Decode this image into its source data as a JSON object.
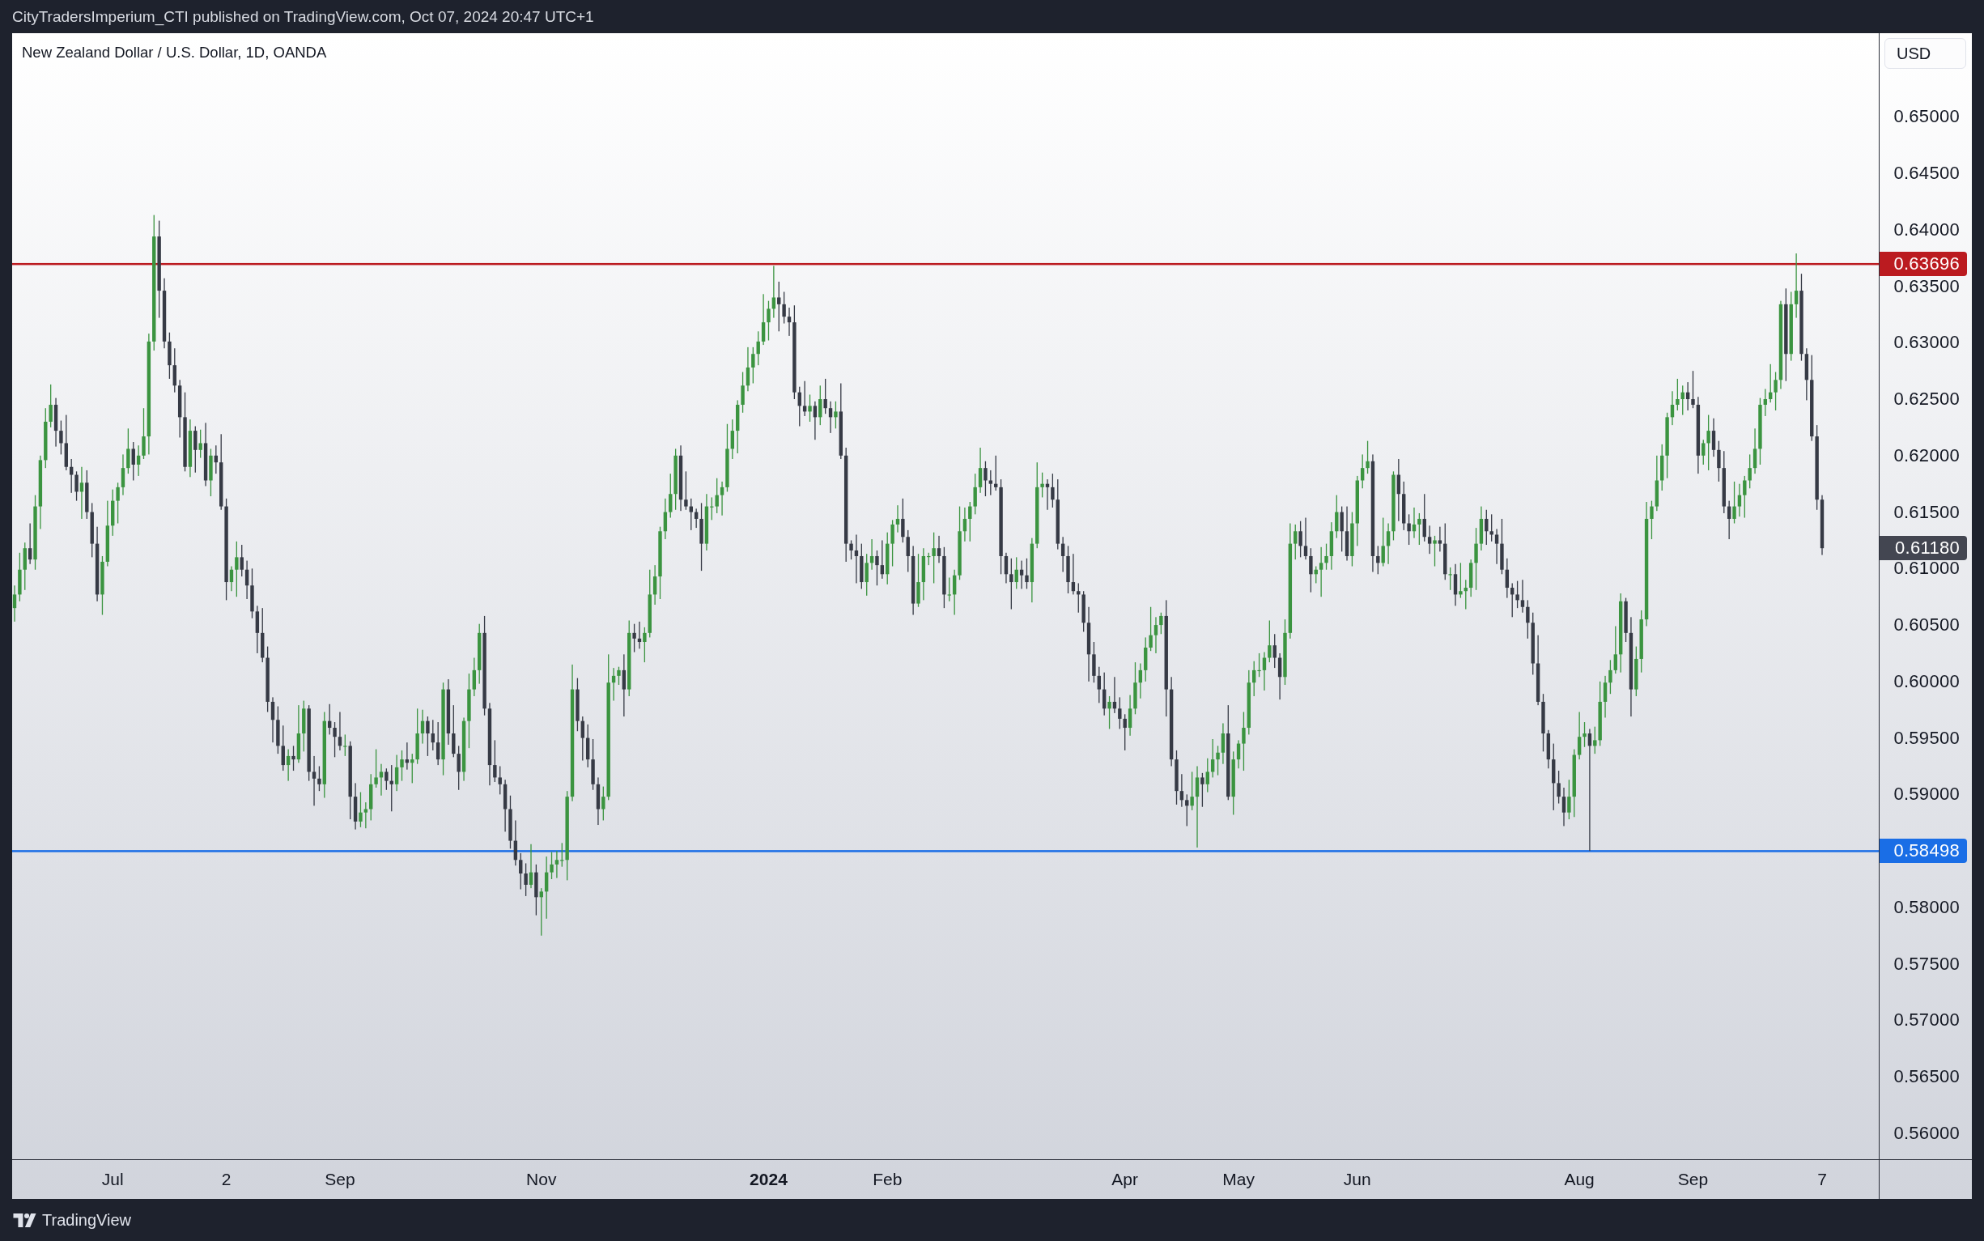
{
  "header": {
    "text": "CityTradersImperium_CTI published on TradingView.com, Oct 07, 2024 20:47 UTC+1"
  },
  "chart": {
    "legend": "New Zealand Dollar / U.S. Dollar, 1D, OANDA",
    "currency_button": "USD",
    "last_price": {
      "label": "0.61180"
    },
    "time_axis": {
      "labels": [
        {
          "bold": false
        },
        {
          "bold": false
        },
        {
          "bold": false
        },
        {
          "bold": false
        },
        {
          "bold": true
        },
        {
          "bold": false
        },
        {
          "bold": false
        },
        {
          "bold": false
        },
        {
          "bold": false
        },
        {
          "bold": false
        },
        {
          "bold": false
        },
        {
          "bold": false
        }
      ]
    },
    "chart_data": {
      "type": "candlestick",
      "ylim": [
        0.5577,
        0.6574
      ],
      "yticks": [
        {
          "value": 0.65,
          "label": "0.65000"
        },
        {
          "value": 0.645,
          "label": "0.64500"
        },
        {
          "value": 0.64,
          "label": "0.64000"
        },
        {
          "value": 0.635,
          "label": "0.63500"
        },
        {
          "value": 0.63,
          "label": "0.63000"
        },
        {
          "value": 0.625,
          "label": "0.62500"
        },
        {
          "value": 0.62,
          "label": "0.62000"
        },
        {
          "value": 0.615,
          "label": "0.61500"
        },
        {
          "value": 0.61,
          "label": "0.61000"
        },
        {
          "value": 0.605,
          "label": "0.60500"
        },
        {
          "value": 0.6,
          "label": "0.60000"
        },
        {
          "value": 0.595,
          "label": "0.59500"
        },
        {
          "value": 0.59,
          "label": "0.59000"
        },
        {
          "value": 0.58,
          "label": "0.58000"
        },
        {
          "value": 0.575,
          "label": "0.57500"
        },
        {
          "value": 0.57,
          "label": "0.57000"
        },
        {
          "value": 0.565,
          "label": "0.56500"
        },
        {
          "value": 0.56,
          "label": "0.56000"
        }
      ],
      "ref_lines": [
        {
          "axis": "y",
          "value": 0.63696,
          "label": "0.63696",
          "color": "#bb1b20"
        },
        {
          "axis": "y",
          "value": 0.58498,
          "label": "0.58498",
          "color": "#1a6ee6"
        }
      ],
      "categories": [
        null,
        null,
        null,
        null,
        null,
        null,
        null,
        null,
        null,
        null,
        null,
        null,
        null,
        null,
        null,
        null,
        null,
        null,
        null,
        "Jul",
        null,
        null,
        null,
        null,
        null,
        null,
        null,
        null,
        null,
        null,
        null,
        null,
        null,
        null,
        null,
        null,
        null,
        null,
        null,
        null,
        null,
        "2",
        null,
        null,
        null,
        null,
        null,
        null,
        null,
        null,
        null,
        null,
        null,
        null,
        null,
        null,
        null,
        null,
        null,
        null,
        null,
        null,
        null,
        "Sep",
        null,
        null,
        null,
        null,
        null,
        null,
        null,
        null,
        null,
        null,
        null,
        null,
        null,
        null,
        null,
        null,
        null,
        null,
        null,
        null,
        null,
        null,
        null,
        null,
        null,
        null,
        null,
        null,
        null,
        null,
        null,
        null,
        null,
        null,
        null,
        null,
        null,
        null,
        "Nov",
        null,
        null,
        null,
        null,
        null,
        null,
        null,
        null,
        null,
        null,
        null,
        null,
        null,
        null,
        null,
        null,
        null,
        null,
        null,
        null,
        null,
        null,
        null,
        null,
        null,
        null,
        null,
        null,
        null,
        null,
        null,
        null,
        null,
        null,
        null,
        null,
        null,
        null,
        null,
        null,
        null,
        null,
        null,
        "2024",
        null,
        null,
        null,
        null,
        null,
        null,
        null,
        null,
        null,
        null,
        null,
        null,
        null,
        null,
        null,
        null,
        null,
        null,
        null,
        null,
        null,
        null,
        "Feb",
        null,
        null,
        null,
        null,
        null,
        null,
        null,
        null,
        null,
        null,
        null,
        null,
        null,
        null,
        null,
        null,
        null,
        null,
        null,
        null,
        null,
        null,
        null,
        null,
        null,
        null,
        null,
        null,
        null,
        null,
        null,
        null,
        null,
        null,
        null,
        null,
        null,
        null,
        null,
        null,
        null,
        null,
        null,
        null,
        null,
        "Apr",
        null,
        null,
        null,
        null,
        null,
        null,
        null,
        null,
        null,
        null,
        null,
        null,
        null,
        null,
        null,
        null,
        null,
        null,
        null,
        null,
        null,
        "May",
        null,
        null,
        null,
        null,
        null,
        null,
        null,
        null,
        null,
        null,
        null,
        null,
        null,
        null,
        null,
        null,
        null,
        null,
        null,
        null,
        null,
        null,
        "Jun",
        null,
        null,
        null,
        null,
        null,
        null,
        null,
        null,
        null,
        null,
        null,
        null,
        null,
        null,
        null,
        null,
        null,
        null,
        null,
        null,
        null,
        null,
        null,
        null,
        null,
        null,
        null,
        null,
        null,
        null,
        null,
        null,
        null,
        null,
        null,
        null,
        null,
        null,
        null,
        null,
        null,
        null,
        "Aug",
        null,
        null,
        null,
        null,
        null,
        null,
        null,
        null,
        null,
        null,
        null,
        null,
        null,
        null,
        null,
        null,
        null,
        null,
        null,
        null,
        null,
        "Sep",
        null,
        null,
        null,
        null,
        null,
        null,
        null,
        null,
        null,
        null,
        null,
        null,
        null,
        null,
        null,
        null,
        null,
        null,
        null,
        null,
        null,
        null,
        null,
        null,
        "7"
      ],
      "ohlc": [
        [
          0.6065,
          0.6085,
          0.6053,
          0.6077
        ],
        [
          0.6077,
          0.6114,
          0.6071,
          0.6099
        ],
        [
          0.6099,
          0.6123,
          0.6081,
          0.6118
        ],
        [
          0.6118,
          0.614,
          0.6104,
          0.6108
        ],
        [
          0.6108,
          0.6165,
          0.6099,
          0.6155
        ],
        [
          0.6155,
          0.62,
          0.6135,
          0.6196
        ],
        [
          0.6196,
          0.6242,
          0.6189,
          0.623
        ],
        [
          0.623,
          0.6263,
          0.6225,
          0.6245
        ],
        [
          0.6245,
          0.6251,
          0.6208,
          0.6222
        ],
        [
          0.6222,
          0.6231,
          0.6201,
          0.6211
        ],
        [
          0.6211,
          0.6236,
          0.6187,
          0.619
        ],
        [
          0.619,
          0.6197,
          0.6167,
          0.6183
        ],
        [
          0.6183,
          0.6186,
          0.616,
          0.6168
        ],
        [
          0.6168,
          0.619,
          0.6144,
          0.6176
        ],
        [
          0.6176,
          0.6187,
          0.6144,
          0.615
        ],
        [
          0.615,
          0.6158,
          0.611,
          0.6122
        ],
        [
          0.6122,
          0.6137,
          0.6071,
          0.6077
        ],
        [
          0.6077,
          0.6111,
          0.6059,
          0.6106
        ],
        [
          0.6106,
          0.616,
          0.6102,
          0.6138
        ],
        [
          0.6138,
          0.617,
          0.6129,
          0.616
        ],
        [
          0.616,
          0.6176,
          0.614,
          0.6172
        ],
        [
          0.6172,
          0.6201,
          0.6165,
          0.6189
        ],
        [
          0.6189,
          0.6224,
          0.6184,
          0.6206
        ],
        [
          0.6206,
          0.6212,
          0.6178,
          0.6192
        ],
        [
          0.6192,
          0.6209,
          0.6182,
          0.62
        ],
        [
          0.62,
          0.6242,
          0.6197,
          0.6217
        ],
        [
          0.6217,
          0.6308,
          0.6201,
          0.6301
        ],
        [
          0.6301,
          0.6413,
          0.6293,
          0.6394
        ],
        [
          0.6394,
          0.6408,
          0.6322,
          0.6346
        ],
        [
          0.6346,
          0.6357,
          0.6295,
          0.6301
        ],
        [
          0.6301,
          0.6309,
          0.6268,
          0.628
        ],
        [
          0.628,
          0.6295,
          0.6256,
          0.6262
        ],
        [
          0.6262,
          0.6267,
          0.6216,
          0.6234
        ],
        [
          0.6234,
          0.6256,
          0.6186,
          0.619
        ],
        [
          0.619,
          0.6232,
          0.6181,
          0.6222
        ],
        [
          0.6222,
          0.6226,
          0.6185,
          0.6205
        ],
        [
          0.6205,
          0.6223,
          0.6198,
          0.6211
        ],
        [
          0.6211,
          0.6229,
          0.6173,
          0.6178
        ],
        [
          0.6178,
          0.6206,
          0.6164,
          0.62
        ],
        [
          0.62,
          0.6209,
          0.6184,
          0.6194
        ],
        [
          0.6194,
          0.6219,
          0.6152,
          0.6155
        ],
        [
          0.6155,
          0.6162,
          0.6072,
          0.6088
        ],
        [
          0.6088,
          0.6102,
          0.608,
          0.6099
        ],
        [
          0.6099,
          0.6124,
          0.6075,
          0.611
        ],
        [
          0.611,
          0.6121,
          0.6093,
          0.6099
        ],
        [
          0.6099,
          0.6107,
          0.6073,
          0.6085
        ],
        [
          0.6085,
          0.61,
          0.6056,
          0.6062
        ],
        [
          0.6062,
          0.6067,
          0.6025,
          0.6043
        ],
        [
          0.6043,
          0.6065,
          0.6017,
          0.6021
        ],
        [
          0.6021,
          0.6031,
          0.5973,
          0.5982
        ],
        [
          0.5982,
          0.5986,
          0.5946,
          0.5966
        ],
        [
          0.5966,
          0.5978,
          0.5936,
          0.5943
        ],
        [
          0.5943,
          0.5961,
          0.5921,
          0.5926
        ],
        [
          0.5926,
          0.594,
          0.5912,
          0.5934
        ],
        [
          0.5934,
          0.5943,
          0.5921,
          0.5931
        ],
        [
          0.5931,
          0.5979,
          0.5928,
          0.5954
        ],
        [
          0.5954,
          0.5983,
          0.5938,
          0.5976
        ],
        [
          0.5976,
          0.5979,
          0.5912,
          0.592
        ],
        [
          0.592,
          0.5934,
          0.589,
          0.5914
        ],
        [
          0.5914,
          0.5925,
          0.5903,
          0.5909
        ],
        [
          0.5909,
          0.5973,
          0.5897,
          0.5965
        ],
        [
          0.5965,
          0.598,
          0.5953,
          0.5959
        ],
        [
          0.5959,
          0.5964,
          0.5933,
          0.5951
        ],
        [
          0.5951,
          0.5973,
          0.5939,
          0.5943
        ],
        [
          0.5943,
          0.5953,
          0.5934,
          0.5943
        ],
        [
          0.5943,
          0.5947,
          0.5878,
          0.5898
        ],
        [
          0.5898,
          0.591,
          0.5869,
          0.5876
        ],
        [
          0.5876,
          0.5902,
          0.5871,
          0.5884
        ],
        [
          0.5884,
          0.5893,
          0.587,
          0.5887
        ],
        [
          0.5887,
          0.5918,
          0.5877,
          0.5909
        ],
        [
          0.5909,
          0.594,
          0.5906,
          0.5915
        ],
        [
          0.5915,
          0.5927,
          0.5899,
          0.592
        ],
        [
          0.592,
          0.5923,
          0.5904,
          0.5912
        ],
        [
          0.5912,
          0.5926,
          0.5885,
          0.5909
        ],
        [
          0.5909,
          0.5935,
          0.5903,
          0.5924
        ],
        [
          0.5924,
          0.5939,
          0.5912,
          0.5931
        ],
        [
          0.5931,
          0.5946,
          0.5922,
          0.5928
        ],
        [
          0.5928,
          0.5936,
          0.591,
          0.5931
        ],
        [
          0.5931,
          0.5976,
          0.5927,
          0.5954
        ],
        [
          0.5954,
          0.5975,
          0.5945,
          0.5965
        ],
        [
          0.5965,
          0.5969,
          0.5934,
          0.5954
        ],
        [
          0.5954,
          0.5966,
          0.5939,
          0.5946
        ],
        [
          0.5946,
          0.5964,
          0.5926,
          0.5931
        ],
        [
          0.5931,
          0.5999,
          0.5917,
          0.5993
        ],
        [
          0.5993,
          0.6002,
          0.5944,
          0.5954
        ],
        [
          0.5954,
          0.5979,
          0.5933,
          0.5936
        ],
        [
          0.5936,
          0.5943,
          0.5904,
          0.592
        ],
        [
          0.592,
          0.5968,
          0.5912,
          0.5965
        ],
        [
          0.5965,
          0.6007,
          0.5941,
          0.5993
        ],
        [
          0.5993,
          0.6021,
          0.5987,
          0.601
        ],
        [
          0.601,
          0.6051,
          0.5998,
          0.6043
        ],
        [
          0.6043,
          0.6058,
          0.597,
          0.5976
        ],
        [
          0.5976,
          0.5981,
          0.5908,
          0.5926
        ],
        [
          0.5926,
          0.5948,
          0.5911,
          0.5915
        ],
        [
          0.5915,
          0.5925,
          0.59,
          0.5909
        ],
        [
          0.5909,
          0.5913,
          0.5867,
          0.5887
        ],
        [
          0.5887,
          0.5899,
          0.5852,
          0.5859
        ],
        [
          0.5859,
          0.5877,
          0.5837,
          0.5842
        ],
        [
          0.5842,
          0.5848,
          0.5816,
          0.583
        ],
        [
          0.583,
          0.5839,
          0.581,
          0.582
        ],
        [
          0.582,
          0.5856,
          0.5817,
          0.5831
        ],
        [
          0.5831,
          0.5838,
          0.5793,
          0.5809
        ],
        [
          0.5809,
          0.5817,
          0.5775,
          0.5814
        ],
        [
          0.5814,
          0.5845,
          0.579,
          0.5831
        ],
        [
          0.5831,
          0.5849,
          0.5825,
          0.5838
        ],
        [
          0.5838,
          0.585,
          0.5826,
          0.5842
        ],
        [
          0.5842,
          0.5857,
          0.5836,
          0.5842
        ],
        [
          0.5842,
          0.5903,
          0.5824,
          0.5898
        ],
        [
          0.5898,
          0.6015,
          0.5894,
          0.5993
        ],
        [
          0.5993,
          0.6003,
          0.5956,
          0.5965
        ],
        [
          0.5965,
          0.5969,
          0.593,
          0.595
        ],
        [
          0.595,
          0.5962,
          0.5924,
          0.5931
        ],
        [
          0.5931,
          0.5949,
          0.5904,
          0.5909
        ],
        [
          0.5909,
          0.5915,
          0.5873,
          0.5887
        ],
        [
          0.5887,
          0.5907,
          0.5877,
          0.5898
        ],
        [
          0.5898,
          0.6024,
          0.5895,
          0.5999
        ],
        [
          0.5999,
          0.6012,
          0.5983,
          0.6005
        ],
        [
          0.6005,
          0.6013,
          0.5997,
          0.601
        ],
        [
          0.601,
          0.6024,
          0.5969,
          0.5993
        ],
        [
          0.5993,
          0.6054,
          0.5987,
          0.6043
        ],
        [
          0.6043,
          0.6051,
          0.6026,
          0.6038
        ],
        [
          0.6038,
          0.6053,
          0.6029,
          0.6035
        ],
        [
          0.6035,
          0.6048,
          0.6017,
          0.6043
        ],
        [
          0.6043,
          0.6099,
          0.6039,
          0.6077
        ],
        [
          0.6077,
          0.6103,
          0.6068,
          0.6093
        ],
        [
          0.6093,
          0.6137,
          0.6073,
          0.6133
        ],
        [
          0.6133,
          0.6162,
          0.6126,
          0.615
        ],
        [
          0.615,
          0.6184,
          0.6145,
          0.6166
        ],
        [
          0.6166,
          0.6206,
          0.6152,
          0.62
        ],
        [
          0.62,
          0.6209,
          0.6151,
          0.6161
        ],
        [
          0.6161,
          0.6186,
          0.6152,
          0.6155
        ],
        [
          0.6155,
          0.6162,
          0.6134,
          0.615
        ],
        [
          0.615,
          0.6153,
          0.6136,
          0.6144
        ],
        [
          0.6144,
          0.6158,
          0.6098,
          0.6122
        ],
        [
          0.6122,
          0.6166,
          0.6116,
          0.6155
        ],
        [
          0.6155,
          0.6163,
          0.6143,
          0.6155
        ],
        [
          0.6155,
          0.618,
          0.6149,
          0.6165
        ],
        [
          0.6165,
          0.6177,
          0.6147,
          0.6172
        ],
        [
          0.6172,
          0.6228,
          0.6168,
          0.6206
        ],
        [
          0.6206,
          0.6232,
          0.6197,
          0.6222
        ],
        [
          0.6222,
          0.6249,
          0.6202,
          0.6245
        ],
        [
          0.6245,
          0.6274,
          0.6238,
          0.6262
        ],
        [
          0.6262,
          0.6296,
          0.6257,
          0.6278
        ],
        [
          0.6278,
          0.6296,
          0.6264,
          0.629
        ],
        [
          0.629,
          0.631,
          0.628,
          0.6301
        ],
        [
          0.6301,
          0.6343,
          0.6298,
          0.6318
        ],
        [
          0.6318,
          0.6337,
          0.6302,
          0.633
        ],
        [
          0.633,
          0.6368,
          0.6322,
          0.634
        ],
        [
          0.634,
          0.6354,
          0.631,
          0.6334
        ],
        [
          0.6334,
          0.6345,
          0.6317,
          0.6323
        ],
        [
          0.6323,
          0.6331,
          0.6306,
          0.6318
        ],
        [
          0.6318,
          0.6333,
          0.625,
          0.6256
        ],
        [
          0.6256,
          0.6261,
          0.6226,
          0.6244
        ],
        [
          0.6244,
          0.6266,
          0.6235,
          0.6239
        ],
        [
          0.6239,
          0.6254,
          0.623,
          0.6244
        ],
        [
          0.6244,
          0.6248,
          0.6214,
          0.6234
        ],
        [
          0.6234,
          0.6262,
          0.6227,
          0.625
        ],
        [
          0.625,
          0.6268,
          0.6237,
          0.6242
        ],
        [
          0.6242,
          0.6248,
          0.622,
          0.6234
        ],
        [
          0.6234,
          0.6248,
          0.6224,
          0.6239
        ],
        [
          0.6239,
          0.6264,
          0.6197,
          0.62
        ],
        [
          0.62,
          0.6207,
          0.6106,
          0.6122
        ],
        [
          0.6122,
          0.6125,
          0.6108,
          0.6116
        ],
        [
          0.6116,
          0.613,
          0.6087,
          0.6111
        ],
        [
          0.6111,
          0.6122,
          0.6082,
          0.6088
        ],
        [
          0.6088,
          0.6113,
          0.6076,
          0.6105
        ],
        [
          0.6105,
          0.6126,
          0.6099,
          0.6111
        ],
        [
          0.6111,
          0.6116,
          0.6085,
          0.6103
        ],
        [
          0.6103,
          0.6125,
          0.6091,
          0.6095
        ],
        [
          0.6095,
          0.6132,
          0.6086,
          0.6122
        ],
        [
          0.6122,
          0.6143,
          0.6102,
          0.6139
        ],
        [
          0.6139,
          0.6156,
          0.6132,
          0.6144
        ],
        [
          0.6144,
          0.6162,
          0.6123,
          0.6128
        ],
        [
          0.6128,
          0.6134,
          0.6097,
          0.6111
        ],
        [
          0.6111,
          0.612,
          0.6059,
          0.6069
        ],
        [
          0.6069,
          0.6113,
          0.6066,
          0.6088
        ],
        [
          0.6088,
          0.6118,
          0.6072,
          0.6111
        ],
        [
          0.6111,
          0.6114,
          0.6103,
          0.6111
        ],
        [
          0.6111,
          0.6132,
          0.6087,
          0.6118
        ],
        [
          0.6118,
          0.6129,
          0.6105,
          0.6111
        ],
        [
          0.6111,
          0.6119,
          0.6065,
          0.6077
        ],
        [
          0.6077,
          0.6092,
          0.6071,
          0.6077
        ],
        [
          0.6077,
          0.6099,
          0.6059,
          0.6094
        ],
        [
          0.6094,
          0.6155,
          0.609,
          0.6133
        ],
        [
          0.6133,
          0.6154,
          0.6124,
          0.6144
        ],
        [
          0.6144,
          0.6159,
          0.6124,
          0.6155
        ],
        [
          0.6155,
          0.6184,
          0.6148,
          0.6172
        ],
        [
          0.6172,
          0.6207,
          0.6167,
          0.6189
        ],
        [
          0.6189,
          0.6195,
          0.6164,
          0.6178
        ],
        [
          0.6178,
          0.6187,
          0.6165,
          0.6175
        ],
        [
          0.6175,
          0.62,
          0.6169,
          0.6172
        ],
        [
          0.6172,
          0.6179,
          0.6095,
          0.6111
        ],
        [
          0.6111,
          0.6114,
          0.6087,
          0.6095
        ],
        [
          0.6095,
          0.6109,
          0.6064,
          0.6088
        ],
        [
          0.6088,
          0.611,
          0.6082,
          0.6099
        ],
        [
          0.6099,
          0.6107,
          0.6082,
          0.6094
        ],
        [
          0.6094,
          0.6109,
          0.6082,
          0.6088
        ],
        [
          0.6088,
          0.6127,
          0.607,
          0.6122
        ],
        [
          0.6122,
          0.6194,
          0.6118,
          0.6172
        ],
        [
          0.6172,
          0.6185,
          0.6163,
          0.6175
        ],
        [
          0.6175,
          0.6179,
          0.6152,
          0.6172
        ],
        [
          0.6172,
          0.6184,
          0.6154,
          0.6161
        ],
        [
          0.6161,
          0.6179,
          0.6117,
          0.6122
        ],
        [
          0.6122,
          0.6128,
          0.6097,
          0.6111
        ],
        [
          0.6111,
          0.612,
          0.6078,
          0.6088
        ],
        [
          0.6088,
          0.6113,
          0.6077,
          0.608
        ],
        [
          0.608,
          0.6087,
          0.6061,
          0.6077
        ],
        [
          0.6077,
          0.608,
          0.6044,
          0.6052
        ],
        [
          0.6052,
          0.6066,
          0.6,
          0.6024
        ],
        [
          0.6024,
          0.6035,
          0.5999,
          0.6005
        ],
        [
          0.6005,
          0.6013,
          0.5981,
          0.5993
        ],
        [
          0.5993,
          0.6008,
          0.597,
          0.5976
        ],
        [
          0.5976,
          0.5987,
          0.5958,
          0.5982
        ],
        [
          0.5982,
          0.6004,
          0.5972,
          0.5976
        ],
        [
          0.5976,
          0.5986,
          0.5958,
          0.5967
        ],
        [
          0.5967,
          0.5971,
          0.5939,
          0.5959
        ],
        [
          0.5959,
          0.5988,
          0.5952,
          0.5976
        ],
        [
          0.5976,
          0.6017,
          0.5971,
          0.5999
        ],
        [
          0.5999,
          0.6016,
          0.5985,
          0.601
        ],
        [
          0.601,
          0.6039,
          0.6,
          0.603
        ],
        [
          0.603,
          0.6066,
          0.6027,
          0.6041
        ],
        [
          0.6041,
          0.6057,
          0.6025,
          0.605
        ],
        [
          0.605,
          0.6061,
          0.6042,
          0.6058
        ],
        [
          0.6058,
          0.6072,
          0.5969,
          0.5993
        ],
        [
          0.5993,
          0.6004,
          0.5925,
          0.5931
        ],
        [
          0.5931,
          0.5939,
          0.5891,
          0.5903
        ],
        [
          0.5903,
          0.5918,
          0.5889,
          0.5895
        ],
        [
          0.5895,
          0.59,
          0.5872,
          0.589
        ],
        [
          0.589,
          0.592,
          0.5886,
          0.5898
        ],
        [
          0.5898,
          0.5925,
          0.5853,
          0.5915
        ],
        [
          0.5915,
          0.5919,
          0.5889,
          0.5909
        ],
        [
          0.5909,
          0.5932,
          0.5902,
          0.592
        ],
        [
          0.592,
          0.5949,
          0.5915,
          0.5931
        ],
        [
          0.5931,
          0.5943,
          0.5917,
          0.5937
        ],
        [
          0.5937,
          0.5963,
          0.5927,
          0.5954
        ],
        [
          0.5954,
          0.5979,
          0.5895,
          0.5898
        ],
        [
          0.5898,
          0.5938,
          0.5882,
          0.5931
        ],
        [
          0.5931,
          0.5948,
          0.5923,
          0.5945
        ],
        [
          0.5945,
          0.5973,
          0.5921,
          0.5959
        ],
        [
          0.5959,
          0.601,
          0.5953,
          0.5999
        ],
        [
          0.5999,
          0.6018,
          0.5987,
          0.601
        ],
        [
          0.601,
          0.6025,
          0.6004,
          0.601
        ],
        [
          0.601,
          0.6026,
          0.5992,
          0.6021
        ],
        [
          0.6021,
          0.6054,
          0.6017,
          0.6032
        ],
        [
          0.6032,
          0.6042,
          0.6012,
          0.6021
        ],
        [
          0.6021,
          0.6025,
          0.5984,
          0.6004
        ],
        [
          0.6004,
          0.6055,
          0.5997,
          0.6043
        ],
        [
          0.6043,
          0.614,
          0.6038,
          0.6122
        ],
        [
          0.6122,
          0.6139,
          0.6108,
          0.6133
        ],
        [
          0.6133,
          0.6142,
          0.611,
          0.612
        ],
        [
          0.612,
          0.6145,
          0.6108,
          0.6111
        ],
        [
          0.6111,
          0.6118,
          0.6079,
          0.6095
        ],
        [
          0.6095,
          0.6102,
          0.6087,
          0.6099
        ],
        [
          0.6099,
          0.6119,
          0.6075,
          0.6105
        ],
        [
          0.6105,
          0.6122,
          0.6099,
          0.6111
        ],
        [
          0.6111,
          0.6141,
          0.6099,
          0.6133
        ],
        [
          0.6133,
          0.6165,
          0.6127,
          0.615
        ],
        [
          0.615,
          0.6155,
          0.6115,
          0.6133
        ],
        [
          0.6133,
          0.6155,
          0.6107,
          0.6111
        ],
        [
          0.6111,
          0.615,
          0.6102,
          0.614
        ],
        [
          0.614,
          0.6182,
          0.612,
          0.6178
        ],
        [
          0.6178,
          0.6201,
          0.6171,
          0.6189
        ],
        [
          0.6189,
          0.6213,
          0.6184,
          0.6195
        ],
        [
          0.6195,
          0.6201,
          0.6097,
          0.6111
        ],
        [
          0.6111,
          0.612,
          0.6095,
          0.6105
        ],
        [
          0.6105,
          0.6145,
          0.6102,
          0.612
        ],
        [
          0.612,
          0.614,
          0.6104,
          0.6133
        ],
        [
          0.6133,
          0.6186,
          0.6125,
          0.6183
        ],
        [
          0.6183,
          0.6197,
          0.6142,
          0.6166
        ],
        [
          0.6166,
          0.6177,
          0.6134,
          0.614
        ],
        [
          0.614,
          0.6148,
          0.6121,
          0.6133
        ],
        [
          0.6133,
          0.6154,
          0.6127,
          0.6139
        ],
        [
          0.6139,
          0.6149,
          0.6121,
          0.6144
        ],
        [
          0.6144,
          0.6166,
          0.6124,
          0.6128
        ],
        [
          0.6128,
          0.6138,
          0.6113,
          0.6122
        ],
        [
          0.6122,
          0.6129,
          0.6102,
          0.6125
        ],
        [
          0.6125,
          0.6137,
          0.6115,
          0.6122
        ],
        [
          0.6122,
          0.614,
          0.609,
          0.6095
        ],
        [
          0.6095,
          0.6101,
          0.6081,
          0.6095
        ],
        [
          0.6095,
          0.6104,
          0.6067,
          0.6077
        ],
        [
          0.6077,
          0.6105,
          0.6074,
          0.608
        ],
        [
          0.608,
          0.609,
          0.6064,
          0.6083
        ],
        [
          0.6083,
          0.6108,
          0.6075,
          0.6105
        ],
        [
          0.6105,
          0.6136,
          0.6081,
          0.6122
        ],
        [
          0.6122,
          0.6155,
          0.6116,
          0.6144
        ],
        [
          0.6144,
          0.6152,
          0.6121,
          0.6133
        ],
        [
          0.6133,
          0.6148,
          0.6124,
          0.613
        ],
        [
          0.613,
          0.6135,
          0.6104,
          0.6122
        ],
        [
          0.6122,
          0.6144,
          0.6095,
          0.6099
        ],
        [
          0.6099,
          0.6109,
          0.6074,
          0.6083
        ],
        [
          0.6083,
          0.6087,
          0.6057,
          0.6077
        ],
        [
          0.6077,
          0.6089,
          0.6065,
          0.6072
        ],
        [
          0.6072,
          0.609,
          0.6061,
          0.6066
        ],
        [
          0.6066,
          0.6072,
          0.6038,
          0.6052
        ],
        [
          0.6052,
          0.6061,
          0.6006,
          0.6016
        ],
        [
          0.6016,
          0.6041,
          0.5979,
          0.5982
        ],
        [
          0.5982,
          0.5989,
          0.5938,
          0.5954
        ],
        [
          0.5954,
          0.5957,
          0.5923,
          0.5931
        ],
        [
          0.5931,
          0.5945,
          0.5886,
          0.591
        ],
        [
          0.591,
          0.5921,
          0.5892,
          0.5898
        ],
        [
          0.5898,
          0.5906,
          0.5872,
          0.5884
        ],
        [
          0.5884,
          0.5913,
          0.5878,
          0.5898
        ],
        [
          0.5898,
          0.594,
          0.588,
          0.5935
        ],
        [
          0.5935,
          0.5973,
          0.5931,
          0.5951
        ],
        [
          0.5951,
          0.5964,
          0.5942,
          0.5954
        ],
        [
          0.5954,
          0.5958,
          0.585,
          0.5943
        ],
        [
          0.5943,
          0.596,
          0.5936,
          0.5948
        ],
        [
          0.5948,
          0.6,
          0.5943,
          0.5982
        ],
        [
          0.5982,
          0.6005,
          0.5968,
          0.5999
        ],
        [
          0.5999,
          0.6019,
          0.5989,
          0.601
        ],
        [
          0.601,
          0.6049,
          0.6007,
          0.6024
        ],
        [
          0.6024,
          0.6078,
          0.6008,
          0.6071
        ],
        [
          0.6071,
          0.6074,
          0.6035,
          0.6043
        ],
        [
          0.6043,
          0.6057,
          0.5969,
          0.5993
        ],
        [
          0.5993,
          0.6031,
          0.5987,
          0.602
        ],
        [
          0.602,
          0.6063,
          0.6008,
          0.6055
        ],
        [
          0.6055,
          0.6159,
          0.6049,
          0.6144
        ],
        [
          0.6144,
          0.616,
          0.6126,
          0.6155
        ],
        [
          0.6155,
          0.62,
          0.6151,
          0.6178
        ],
        [
          0.6178,
          0.621,
          0.6169,
          0.62
        ],
        [
          0.62,
          0.6238,
          0.618,
          0.6234
        ],
        [
          0.6234,
          0.6257,
          0.6227,
          0.6245
        ],
        [
          0.6245,
          0.6268,
          0.624,
          0.625
        ],
        [
          0.625,
          0.6262,
          0.6236,
          0.6256
        ],
        [
          0.6256,
          0.6265,
          0.624,
          0.625
        ],
        [
          0.625,
          0.6275,
          0.6242,
          0.6245
        ],
        [
          0.6245,
          0.6252,
          0.6184,
          0.62
        ],
        [
          0.62,
          0.6214,
          0.6192,
          0.6211
        ],
        [
          0.6211,
          0.6236,
          0.6187,
          0.6222
        ],
        [
          0.6222,
          0.6233,
          0.6199,
          0.6205
        ],
        [
          0.6205,
          0.6213,
          0.6177,
          0.6189
        ],
        [
          0.6189,
          0.6204,
          0.6149,
          0.6155
        ],
        [
          0.6155,
          0.616,
          0.6126,
          0.6144
        ],
        [
          0.6144,
          0.6177,
          0.614,
          0.6155
        ],
        [
          0.6155,
          0.6175,
          0.6146,
          0.6165
        ],
        [
          0.6165,
          0.6182,
          0.6145,
          0.6178
        ],
        [
          0.6178,
          0.6201,
          0.6171,
          0.6189
        ],
        [
          0.6189,
          0.6224,
          0.6184,
          0.6206
        ],
        [
          0.6206,
          0.6251,
          0.6192,
          0.6245
        ],
        [
          0.6245,
          0.6259,
          0.6235,
          0.625
        ],
        [
          0.625,
          0.6281,
          0.6247,
          0.6256
        ],
        [
          0.6256,
          0.6274,
          0.624,
          0.6267
        ],
        [
          0.6267,
          0.6337,
          0.6259,
          0.6334
        ],
        [
          0.6334,
          0.6348,
          0.6266,
          0.629
        ],
        [
          0.629,
          0.6345,
          0.6284,
          0.6334
        ],
        [
          0.6334,
          0.6379,
          0.6322,
          0.6346
        ],
        [
          0.6346,
          0.6361,
          0.6284,
          0.629
        ],
        [
          0.629,
          0.6295,
          0.6249,
          0.6267
        ],
        [
          0.6267,
          0.6289,
          0.6213,
          0.6217
        ],
        [
          0.6217,
          0.6227,
          0.6152,
          0.6161
        ],
        [
          0.6161,
          0.6165,
          0.6112,
          0.6118
        ]
      ]
    }
  },
  "footer": {
    "logo_text": "TradingView"
  }
}
